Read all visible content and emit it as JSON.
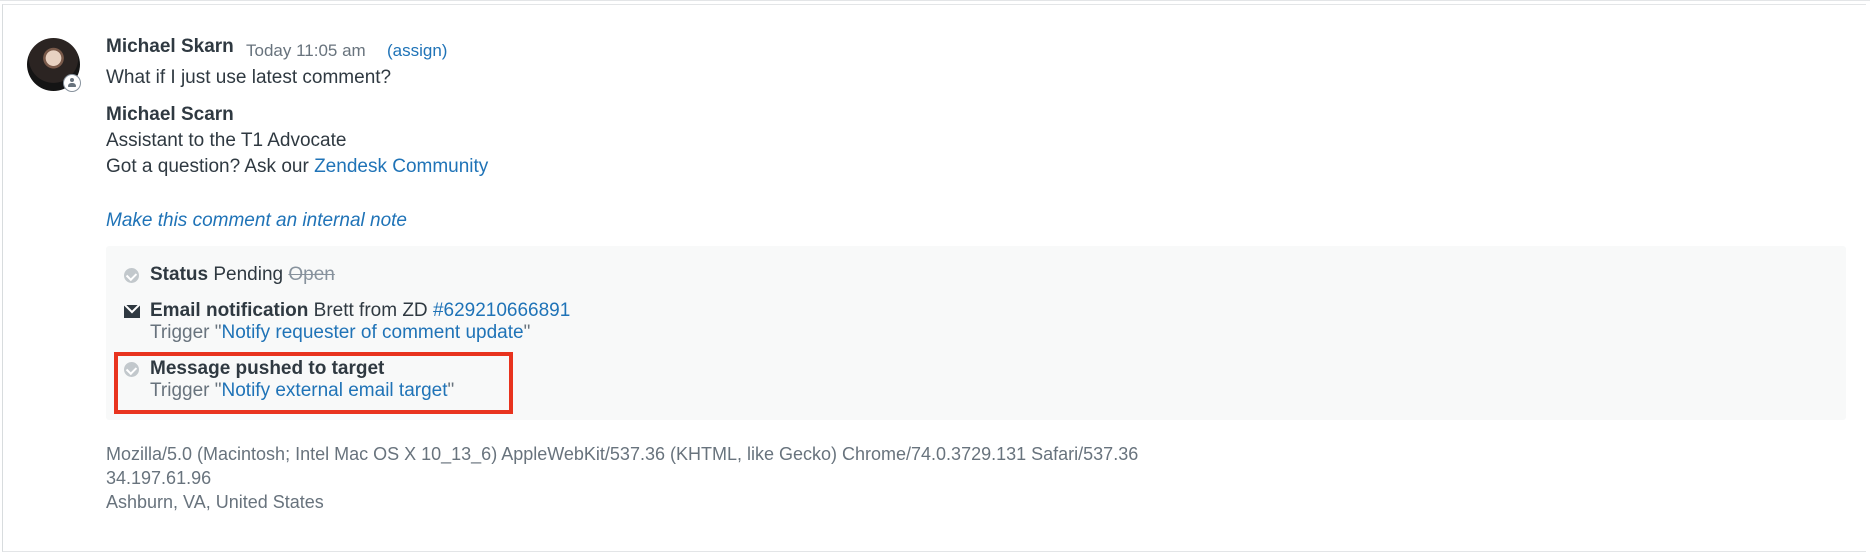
{
  "comment": {
    "author": "Michael Skarn",
    "time": "Today 11:05 am",
    "assign_label": "(assign)",
    "text": "What if I just use latest comment?",
    "signature": {
      "name": "Michael Scarn",
      "title": "Assistant to the T1 Advocate",
      "question_prefix": "Got a question? Ask our",
      "community_link": "Zendesk Community"
    },
    "internal_note_link": "Make this comment an internal note"
  },
  "events": {
    "status": {
      "label": "Status",
      "new_value": "Pending",
      "old_value": "Open",
      "icon": "check-circle-icon"
    },
    "email": {
      "label": "Email notification",
      "recipient": "Brett from ZD",
      "ticket_link": "#629210666891",
      "trigger_prefix": "Trigger \"",
      "trigger_name": "Notify requester of comment update",
      "trigger_suffix": "\"",
      "icon": "envelope-icon"
    },
    "target": {
      "label": "Message pushed to target",
      "trigger_prefix": "Trigger \"",
      "trigger_name": "Notify external email target",
      "trigger_suffix": "\"",
      "icon": "check-circle-icon"
    }
  },
  "metadata": {
    "user_agent": "Mozilla/5.0 (Macintosh; Intel Mac OS X 10_13_6) AppleWebKit/537.36 (KHTML, like Gecko) Chrome/74.0.3729.131 Safari/537.36",
    "ip": "34.197.61.96",
    "location": "Ashburn, VA, United States"
  },
  "colors": {
    "link": "#1f73b7",
    "highlight": "#e8331e",
    "muted": "#68737d"
  }
}
